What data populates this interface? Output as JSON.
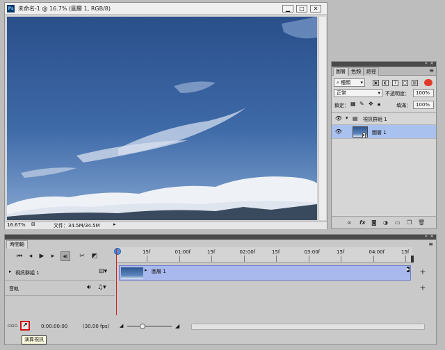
{
  "document": {
    "title": "未命名-1 @ 16.7% (圖層 1, RGB/8)",
    "zoom": "16.67%",
    "file_info": "文件：34.5M/34.5M",
    "app_icon": "Ps"
  },
  "layers_panel": {
    "tabs": [
      "圖層",
      "色頻",
      "路徑"
    ],
    "filter_kind": "種類",
    "blend_mode": "正常",
    "opacity_label": "不透明度：",
    "opacity_value": "100%",
    "lock_label": "鎖定：",
    "fill_label": "填滿：",
    "fill_value": "100%",
    "group_name": "視訊群組 1",
    "layer_name": "圖層 1"
  },
  "timeline": {
    "tab": "時間軸",
    "ruler_ticks": [
      "15f",
      "01:00f",
      "15f",
      "02:00f",
      "15f",
      "03:00f",
      "15f",
      "04:00f",
      "15f"
    ],
    "group_track": "視訊群組 1",
    "clip_label": "圖層 1",
    "audio_track": "音軌",
    "timecode": "0:00:00:00",
    "fps": "(30.00 fps)",
    "tooltip": "演算視訊"
  },
  "colors": {
    "selected_layer": "#a9c1ee",
    "clip": "#a9b9ee",
    "playhead": "#cc2222"
  }
}
